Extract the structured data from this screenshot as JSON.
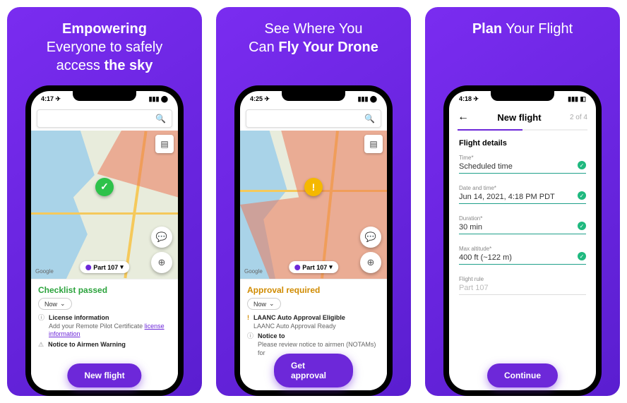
{
  "panels": {
    "p1": {
      "headline_pre": "Empowering",
      "headline_mid": "Everyone to safely",
      "headline_post_pre": "access ",
      "headline_bold": "the sky"
    },
    "p2": {
      "headline_pre": "See Where You",
      "headline_mid_pre": "Can ",
      "headline_bold": "Fly Your Drone"
    },
    "p3": {
      "headline_bold": "Plan",
      "headline_post": " Your Flight"
    }
  },
  "statusbar": {
    "time1": "4:17",
    "time2": "4:25",
    "time3": "4:18"
  },
  "map": {
    "google": "Google",
    "chip": "Part 107",
    "chip_caret": "▾"
  },
  "sheet1": {
    "status": "Checklist passed",
    "now": "Now",
    "info_title": "License information",
    "info_body_pre": "Add your Remote Pilot Certificate ",
    "info_link": "license information",
    "notam_title": "Notice to Airmen Warning",
    "cta": "New flight"
  },
  "sheet2": {
    "status": "Approval required",
    "now": "Now",
    "laanc_title": "LAANC Auto Approval Eligible",
    "laanc_body": "LAANC Auto Approval Ready",
    "notice_title": "Notice to",
    "notice_body": "Please review notice to airmen (NOTAMs) for",
    "cta": "Get approval"
  },
  "form": {
    "title": "New flight",
    "steps": "2 of 4",
    "section": "Flight details",
    "time_label": "Time*",
    "time_value": "Scheduled time",
    "date_label": "Date and time*",
    "date_value": "Jun 14, 2021, 4:18 PM PDT",
    "duration_label": "Duration*",
    "duration_value": "30 min",
    "alt_label": "Max altitude*",
    "alt_value": "400 ft (~122 m)",
    "rule_label": "Flight rule",
    "rule_value": "Part 107",
    "cta": "Continue"
  }
}
